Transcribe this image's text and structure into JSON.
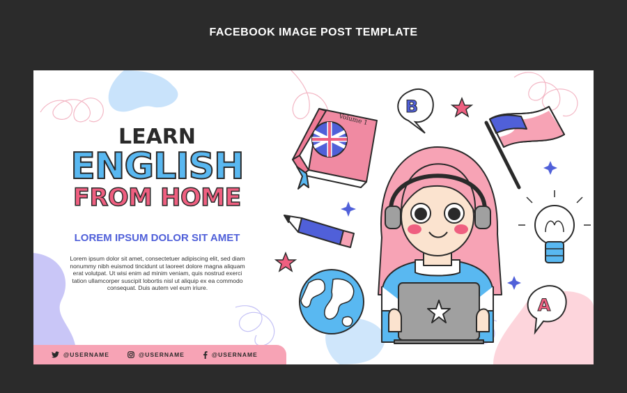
{
  "header": {
    "title": "FACEBOOK IMAGE POST TEMPLATE"
  },
  "headline": {
    "line1": "LEARN",
    "line2": "ENGLISH",
    "line3": "FROM HOME"
  },
  "subtitle": "LOREM IPSUM DOLOR SIT AMET",
  "body": "Lorem ipsum dolor sit amet, consectetuer adipiscing elit, sed diam nonummy nibh euismod tincidunt ut laoreet dolore magna aliquam erat volutpat. Ut wisi enim ad minim veniam, quis nostrud exerci tation ullamcorper suscipit lobortis nisl ut aliquip ex ea commodo consequat. Duis autem vel eum iriure.",
  "socials": [
    {
      "icon": "twitter-icon",
      "handle": "@USERNAME"
    },
    {
      "icon": "instagram-icon",
      "handle": "@USERNAME"
    },
    {
      "icon": "facebook-icon",
      "handle": "@USERNAME"
    }
  ],
  "illustration": {
    "book_label": "Volume 1",
    "bubble_top": "B",
    "bubble_bottom": "A"
  },
  "colors": {
    "background": "#2b2b2b",
    "card": "#ffffff",
    "blue": "#59b8f1",
    "pink": "#ef5f80",
    "indigo": "#5060d9",
    "social_bar": "#f7a3b5"
  }
}
